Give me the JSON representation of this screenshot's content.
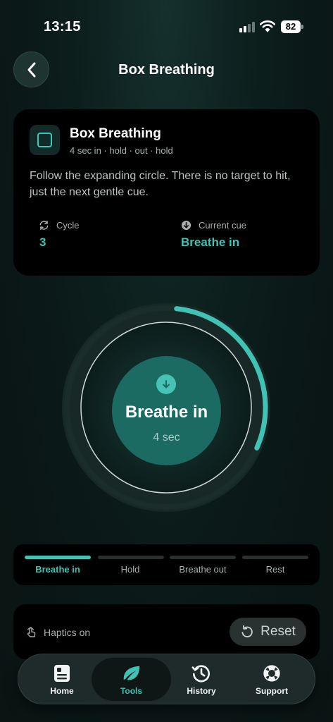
{
  "status_bar": {
    "time": "13:15",
    "battery": "82"
  },
  "header": {
    "title": "Box Breathing"
  },
  "info_card": {
    "title": "Box Breathing",
    "subtitle": "4 sec in · hold · out · hold",
    "description": "Follow the expanding circle. There is no target to hit, just the next gentle cue.",
    "cycle_label": "Cycle",
    "cycle_value": "3",
    "cue_label": "Current cue",
    "cue_value": "Breathe in"
  },
  "breath": {
    "phase": "Breathe in",
    "seconds": "4 sec",
    "progress": 0.3
  },
  "phases": [
    {
      "label": "Breathe in",
      "active": true
    },
    {
      "label": "Hold",
      "active": false
    },
    {
      "label": "Breathe out",
      "active": false
    },
    {
      "label": "Rest",
      "active": false
    }
  ],
  "controls": {
    "haptics_label": "Haptics on",
    "reset_label": "Reset"
  },
  "tabs": [
    {
      "label": "Home",
      "icon": "home-card-icon",
      "active": false
    },
    {
      "label": "Tools",
      "icon": "leaf-icon",
      "active": true
    },
    {
      "label": "History",
      "icon": "history-icon",
      "active": false
    },
    {
      "label": "Support",
      "icon": "lifebuoy-icon",
      "active": false
    }
  ],
  "colors": {
    "accent": "#40c2b4",
    "card": "#000000",
    "disc": "#1b6b63"
  }
}
